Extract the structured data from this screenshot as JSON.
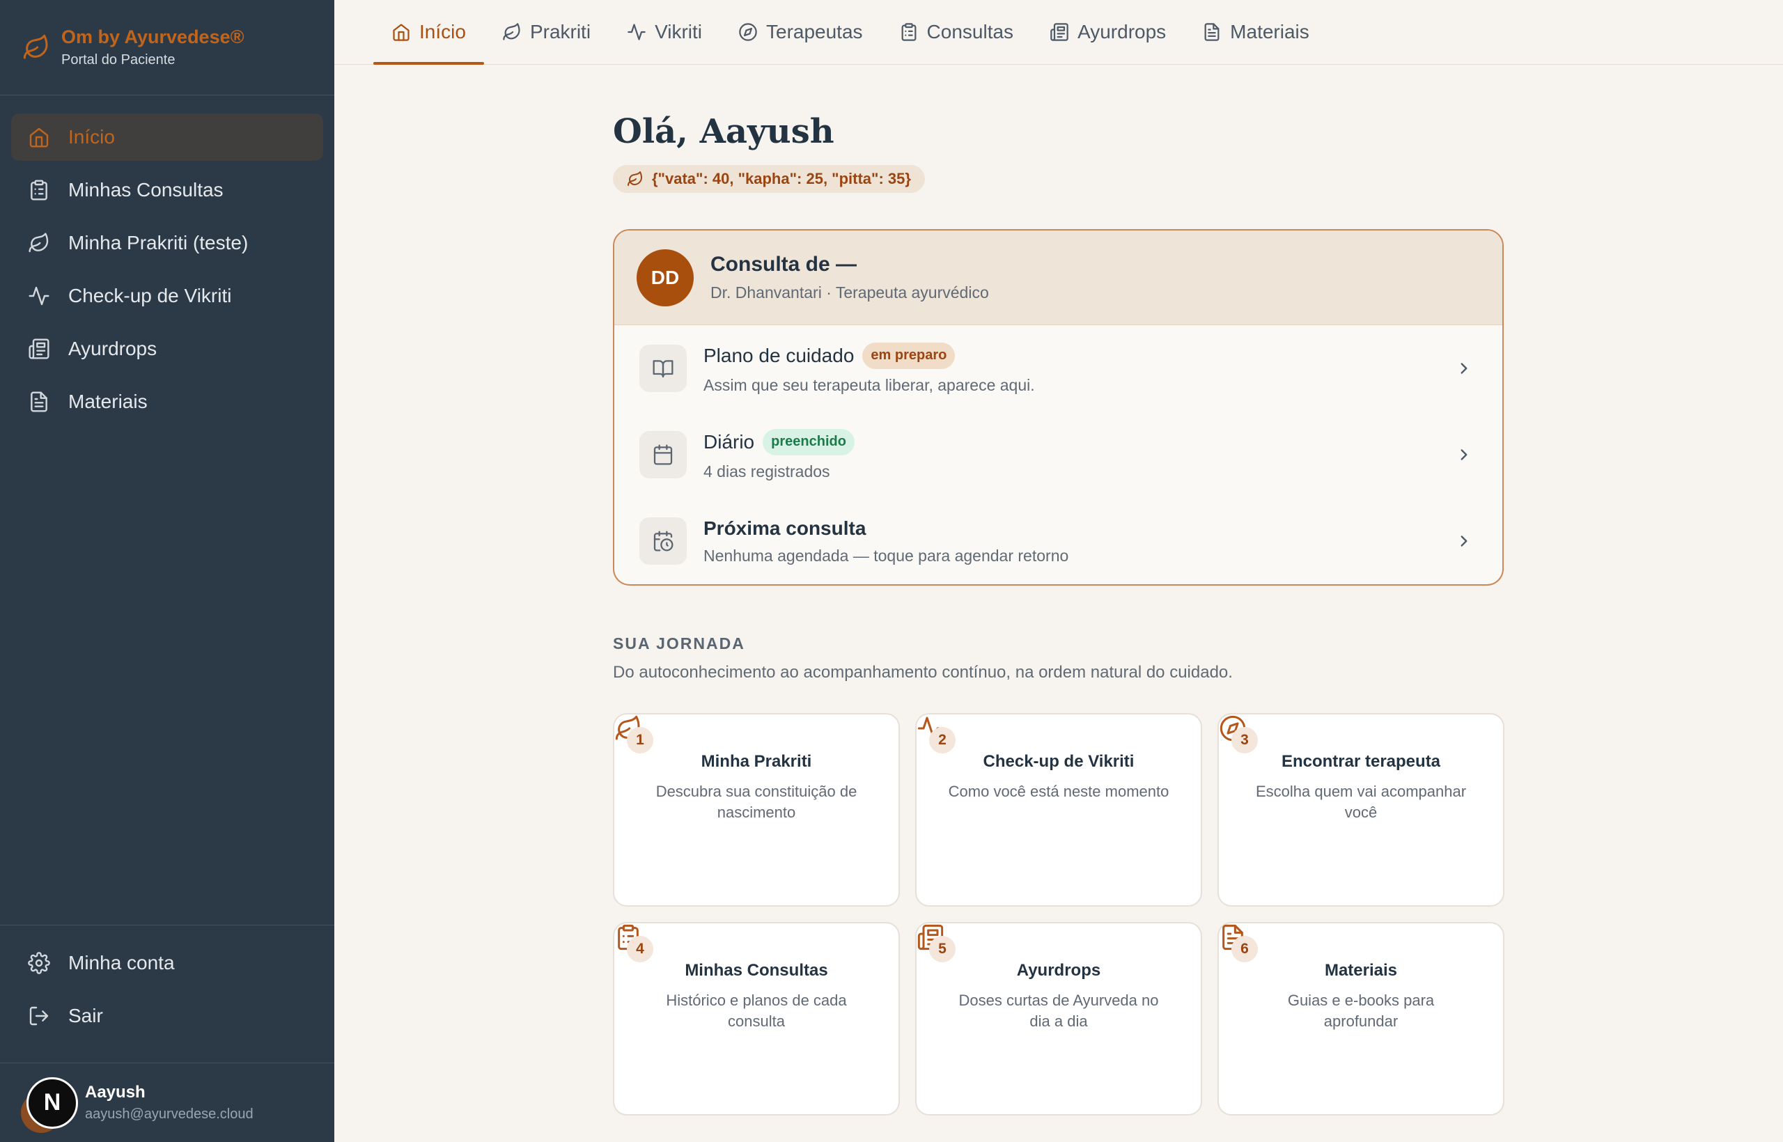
{
  "brand": {
    "title": "Om by Ayurvedese®",
    "subtitle": "Portal do Paciente",
    "accent": "#c2651a"
  },
  "sidebar": {
    "items": [
      {
        "label": "Início",
        "icon": "home-icon",
        "active": true
      },
      {
        "label": "Minhas Consultas",
        "icon": "clipboard-icon"
      },
      {
        "label": "Minha Prakriti (teste)",
        "icon": "leaf-icon"
      },
      {
        "label": "Check-up de Vikriti",
        "icon": "activity-icon"
      },
      {
        "label": "Ayurdrops",
        "icon": "newspaper-icon"
      },
      {
        "label": "Materiais",
        "icon": "document-icon"
      }
    ],
    "bottom": [
      {
        "label": "Minha conta",
        "icon": "gear-icon"
      },
      {
        "label": "Sair",
        "icon": "logout-icon"
      }
    ],
    "user": {
      "name": "Aayush",
      "email": "aayush@ayurvedese.cloud",
      "avatar_letter": "N"
    }
  },
  "tabs": [
    {
      "label": "Início",
      "icon": "home-icon",
      "active": true
    },
    {
      "label": "Prakriti",
      "icon": "leaf-icon"
    },
    {
      "label": "Vikriti",
      "icon": "activity-icon"
    },
    {
      "label": "Terapeutas",
      "icon": "compass-icon"
    },
    {
      "label": "Consultas",
      "icon": "clipboard-icon"
    },
    {
      "label": "Ayurdrops",
      "icon": "newspaper-icon"
    },
    {
      "label": "Materiais",
      "icon": "document-icon"
    }
  ],
  "main": {
    "greeting": "Olá, Aayush",
    "dosha": "{\"vata\": 40, \"kapha\": 25, \"pitta\": 35}",
    "consult": {
      "initials": "DD",
      "title": "Consulta de —",
      "subtitle": "Dr. Dhanvantari · Terapeuta ayurvédico",
      "rows": [
        {
          "title": "Plano de cuidado",
          "badge": "em preparo",
          "subtitle": "Assim que seu terapeuta liberar, aparece aqui.",
          "icon": "book-icon"
        },
        {
          "title": "Diário",
          "badge": "preenchido",
          "subtitle": "4 dias registrados",
          "icon": "calendar-icon"
        },
        {
          "title": "Próxima consulta",
          "subtitle": "Nenhuma agendada — toque para agendar retorno",
          "icon": "calendar-clock-icon"
        }
      ]
    },
    "journey": {
      "title": "SUA JORNADA",
      "subtitle": "Do autoconhecimento ao acompanhamento contínuo, na ordem natural do cuidado.",
      "steps": [
        {
          "num": "1",
          "title": "Minha Prakriti",
          "desc": "Descubra sua constituição de nascimento",
          "icon": "leaf-icon"
        },
        {
          "num": "2",
          "title": "Check-up de Vikriti",
          "desc": "Como você está neste momento",
          "icon": "activity-icon"
        },
        {
          "num": "3",
          "title": "Encontrar terapeuta",
          "desc": "Escolha quem vai acompanhar você",
          "icon": "compass-icon"
        },
        {
          "num": "4",
          "title": "Minhas Consultas",
          "desc": "Histórico e planos de cada consulta",
          "icon": "clipboard-icon"
        },
        {
          "num": "5",
          "title": "Ayurdrops",
          "desc": "Doses curtas de Ayurveda no dia a dia",
          "icon": "newspaper-icon"
        },
        {
          "num": "6",
          "title": "Materiais",
          "desc": "Guias e e-books para aprofundar",
          "icon": "document-icon"
        }
      ]
    }
  }
}
